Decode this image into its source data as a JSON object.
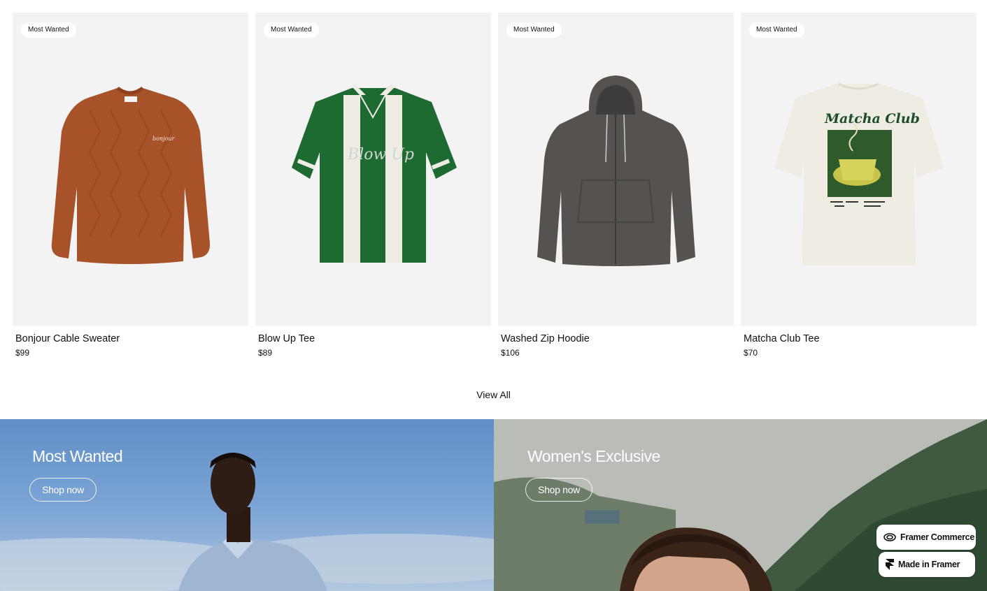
{
  "products": [
    {
      "badge": "Most Wanted",
      "name": "Bonjour Cable Sweater",
      "price": "$99",
      "image": "orange cable-knit sweater",
      "color": "#a8522a"
    },
    {
      "badge": "Most Wanted",
      "name": "Blow Up Tee",
      "price": "$89",
      "image": "green and white striped polo",
      "color": "#1e6b32"
    },
    {
      "badge": "Most Wanted",
      "name": "Washed Zip Hoodie",
      "price": "$106",
      "image": "charcoal zip hoodie",
      "color": "#55524f"
    },
    {
      "badge": "Most Wanted",
      "name": "Matcha Club Tee",
      "price": "$70",
      "image": "cream graphic tee",
      "color": "#efece4"
    }
  ],
  "view_all_label": "View All",
  "banners": [
    {
      "title": "Most Wanted",
      "button": "Shop now",
      "image": "man in blue shirt against sky"
    },
    {
      "title": "Women's Exclusive",
      "button": "Shop now",
      "image": "woman with bangs near mountains"
    }
  ],
  "framer": {
    "commerce_label": "Framer Commerce",
    "made_label": "Made in Framer"
  },
  "colors": {
    "card_background": "#f3f3f3",
    "text": "#111111"
  }
}
